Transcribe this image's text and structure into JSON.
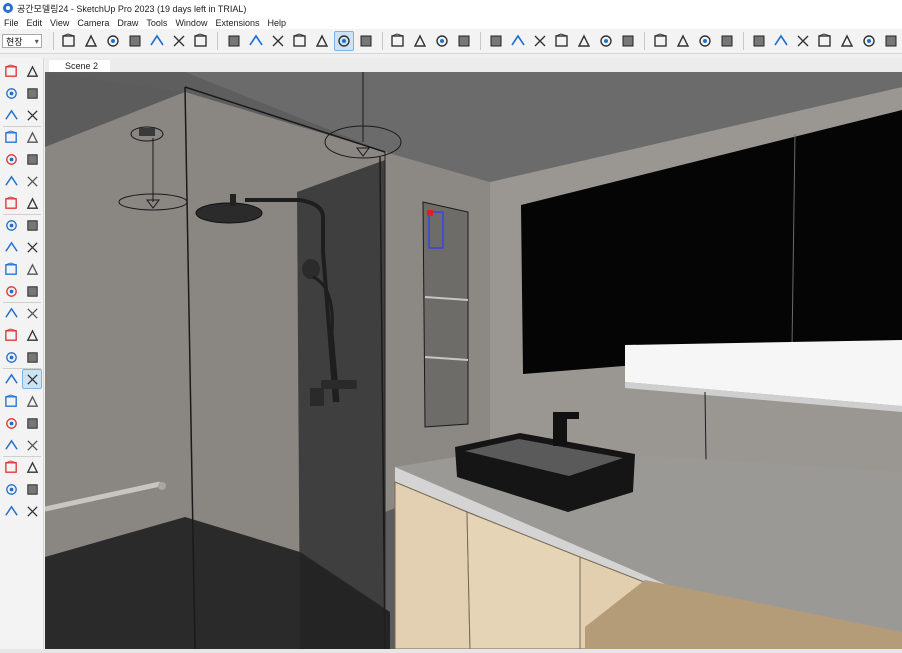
{
  "window": {
    "title": "공간모델링24 - SketchUp Pro 2023 (19 days left in TRIAL)"
  },
  "menu": [
    "File",
    "Edit",
    "View",
    "Camera",
    "Draw",
    "Tools",
    "Window",
    "Extensions",
    "Help"
  ],
  "toolbar": {
    "layer_select": {
      "value": "현장"
    },
    "groups": [
      {
        "name": "views",
        "buttons": [
          "iso-view-icon",
          "top-view-icon",
          "front-view-icon",
          "right-view-icon",
          "back-view-icon",
          "left-view-icon",
          "bottom-view-icon"
        ]
      },
      {
        "name": "styles",
        "buttons": [
          "xray-icon",
          "back-edges-icon",
          "wireframe-icon",
          "hidden-line-icon",
          "shaded-icon",
          "shaded-textures-icon",
          "monochrome-icon"
        ]
      },
      {
        "name": "warehouse",
        "buttons": [
          "3d-warehouse-icon",
          "share-model-icon",
          "extension-warehouse-icon",
          "layout-icon"
        ]
      },
      {
        "name": "sandbox",
        "buttons": [
          "from-contours-icon",
          "from-scratch-icon",
          "smoove-icon",
          "stamp-icon",
          "drape-icon",
          "add-detail-icon",
          "flip-edge-icon"
        ]
      },
      {
        "name": "sections",
        "buttons": [
          "section-plane-icon",
          "display-sections-icon",
          "section-cuts-icon",
          "section-fill-icon"
        ]
      },
      {
        "name": "extras",
        "buttons": [
          "components-icon",
          "materials-icon",
          "soften-icon",
          "styles-icon",
          "shadows-icon",
          "fog-icon",
          "match-photo-icon"
        ]
      }
    ],
    "active_style": "shaded-textures-icon"
  },
  "palette": {
    "tools": [
      "select-icon",
      "orbit-icon",
      "paint-bucket-icon",
      "eraser-icon",
      "make-component-icon",
      "tag-tool-icon",
      "line-icon",
      "freehand-icon",
      "rectangle-icon",
      "rotated-rectangle-icon",
      "circle-icon",
      "polygon-icon",
      "arc-icon",
      "two-point-arc-icon",
      "three-point-arc-icon",
      "pie-icon",
      "push-pull-icon",
      "move-icon",
      "rotate-icon",
      "follow-me-icon",
      "scale-icon",
      "offset-icon",
      "tape-measure-icon",
      "dimension-icon",
      "protractor-icon",
      "text-icon",
      "axes-icon",
      "3d-text-icon",
      "orbit-view-icon",
      "pan-icon",
      "zoom-icon",
      "zoom-window-icon",
      "zoom-extents-icon",
      "previous-view-icon",
      "position-camera-icon",
      "walk-icon",
      "look-around-icon",
      "section-plane-tool-icon",
      "sandbox-icon",
      "sandbox-smoove-icon",
      "sandbox-stamp-icon",
      "sandbox-flip-icon"
    ],
    "active_tool": "pan-icon"
  },
  "scenes": {
    "tabs": [
      {
        "label": "Scene 2"
      }
    ]
  },
  "colors": {
    "accent": "#1f6fd1",
    "active_bg": "#cfe3f7",
    "wall": "#8f8c88",
    "ceiling": "#6a6a6a",
    "mirror": "#050505",
    "cabinet": "#e4d1b3",
    "countertop": "#9a9896"
  }
}
